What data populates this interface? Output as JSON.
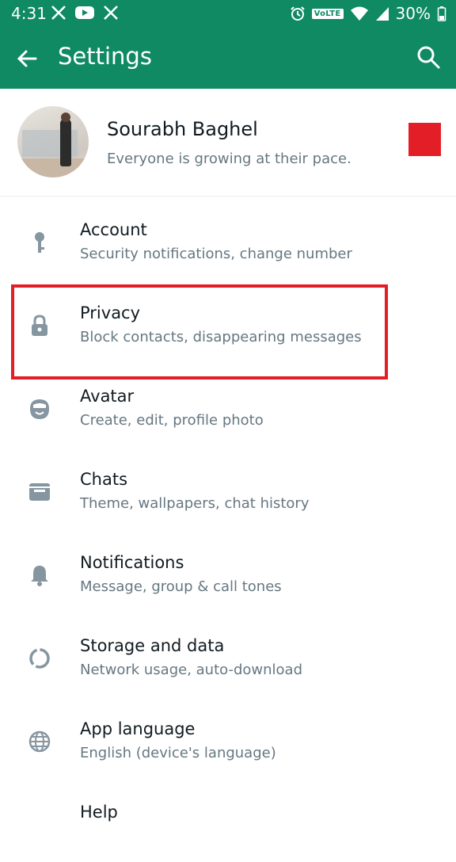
{
  "status_bar": {
    "time": "4:31",
    "volte_label": "VoLTE",
    "battery": "30%"
  },
  "app_bar": {
    "title": "Settings"
  },
  "profile": {
    "name": "Sourabh Baghel",
    "status": "Everyone is growing at their pace."
  },
  "settings_items": [
    {
      "label": "Account",
      "subtitle": "Security notifications, change number",
      "icon": "key-icon"
    },
    {
      "label": "Privacy",
      "subtitle": "Block contacts, disappearing messages",
      "icon": "lock-icon"
    },
    {
      "label": "Avatar",
      "subtitle": "Create, edit, profile photo",
      "icon": "avatar-face-icon"
    },
    {
      "label": "Chats",
      "subtitle": "Theme, wallpapers, chat history",
      "icon": "chat-icon"
    },
    {
      "label": "Notifications",
      "subtitle": "Message, group & call tones",
      "icon": "bell-icon"
    },
    {
      "label": "Storage and data",
      "subtitle": "Network usage, auto-download",
      "icon": "storage-circle-icon"
    },
    {
      "label": "App language",
      "subtitle": "English (device's language)",
      "icon": "globe-icon"
    },
    {
      "label": "Help",
      "subtitle": "",
      "icon": "help-icon"
    }
  ],
  "colors": {
    "app_bar": "#0f8a63",
    "highlight": "#e41e26",
    "icon": "#8696a0",
    "primary_text": "#111b21",
    "secondary_text": "#667781"
  }
}
